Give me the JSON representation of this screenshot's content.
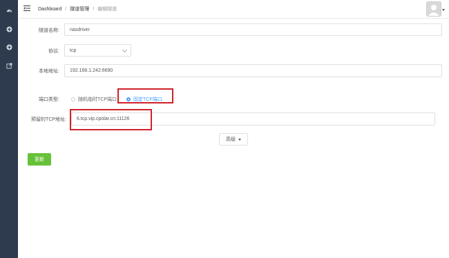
{
  "sidebar": {
    "items": [
      {
        "icon": "dashboard-icon"
      },
      {
        "icon": "plus-circle-icon"
      },
      {
        "icon": "plus-circle-icon"
      },
      {
        "icon": "external-link-icon"
      }
    ]
  },
  "header": {
    "breadcrumb": [
      "Dashboard",
      "隧道管理",
      "编辑隧道"
    ]
  },
  "form": {
    "tunnel_name": {
      "label": "隧道名称:",
      "value": "nasdriver"
    },
    "protocol": {
      "label": "协议:",
      "value": "tcp"
    },
    "local_address": {
      "label": "本地地址:",
      "value": "192.168.1.242:6690"
    },
    "port_type": {
      "label": "端口类型:",
      "options": [
        "随机临时TCP端口",
        "固定TCP端口"
      ],
      "selected": "固定TCP端口"
    },
    "reserved_tcp": {
      "label": "预留的TCP地址:",
      "value": "6.tcp.vip.cpolar.cn:11126"
    },
    "advanced_label": "高级",
    "update_label": "更新"
  },
  "colors": {
    "sidebar": "#2e3b4e",
    "accent": "#409eff",
    "highlight": "#d0202a",
    "update_button": "#67c23a"
  }
}
